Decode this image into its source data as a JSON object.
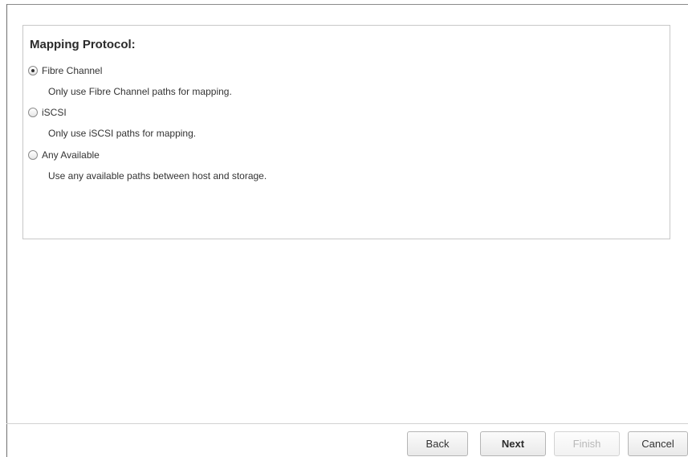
{
  "section": {
    "title": "Mapping Protocol:"
  },
  "options": [
    {
      "label": "Fibre Channel",
      "description": "Only use Fibre Channel paths for mapping.",
      "selected": true
    },
    {
      "label": "iSCSI",
      "description": "Only use iSCSI paths for mapping.",
      "selected": false
    },
    {
      "label": "Any Available",
      "description": "Use any available paths between host and storage.",
      "selected": false
    }
  ],
  "footer": {
    "back_label": "Back",
    "next_label": "Next",
    "finish_label": "Finish",
    "cancel_label": "Cancel",
    "finish_enabled": false
  }
}
